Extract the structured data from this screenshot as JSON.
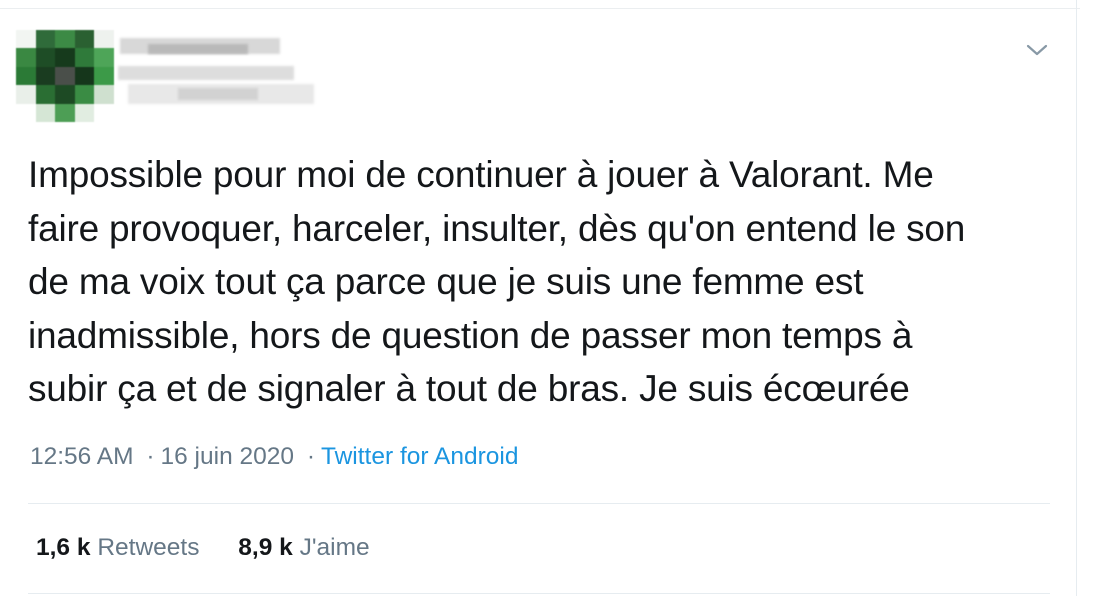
{
  "tweet": {
    "text_lines": [
      "Impossible pour moi de continuer à jouer à Valorant. Me",
      "faire provoquer, harceler, insulter, dès qu'on entend le son",
      "de ma voix tout ça parce que je suis une femme est",
      "inadmissible, hors de question de passer mon temps à",
      "subir ça et de signaler à tout de bras. Je suis écœurée"
    ],
    "time": "12:56 AM",
    "separator": "·",
    "date": "16 juin 2020",
    "source": "Twitter for Android"
  },
  "stats": {
    "retweets_count": "1,6 k",
    "retweets_label": "Retweets",
    "likes_count": "8,9 k",
    "likes_label": "J'aime"
  },
  "icons": {
    "menu": "chevron-down-icon"
  },
  "colors": {
    "text": "#14171a",
    "secondary": "#657786",
    "link": "#1b95e0",
    "border": "#e6ecf0"
  }
}
